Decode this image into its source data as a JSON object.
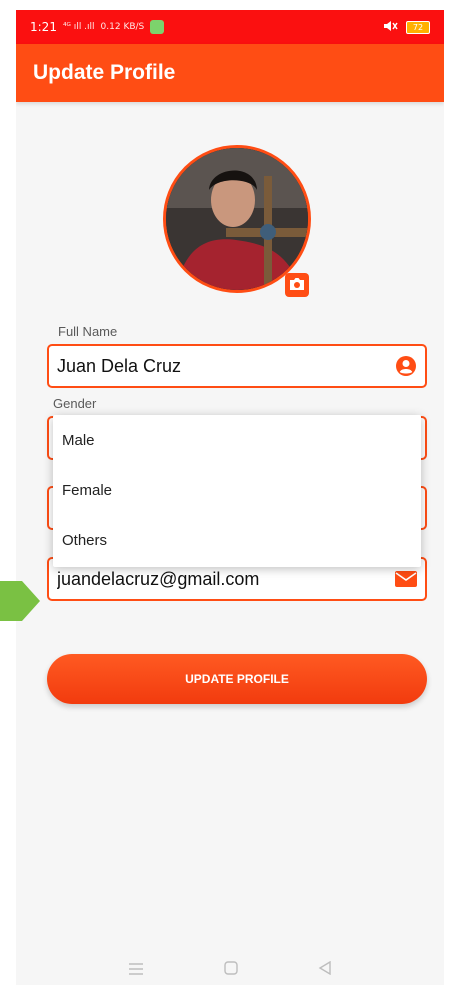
{
  "status_bar": {
    "time": "1:21",
    "network_labels": "⁴ᴳ ıll .ıll",
    "speed": "0.12 KB/S",
    "battery": "72"
  },
  "app_bar": {
    "title": "Update Profile"
  },
  "form": {
    "full_name_label": "Full Name",
    "full_name_value": "Juan Dela Cruz",
    "gender_label": "Gender",
    "email_value": "juandelacruz@gmail.com"
  },
  "gender_dropdown": {
    "options": [
      "Male",
      "Female",
      "Others"
    ]
  },
  "actions": {
    "update_label": "UPDATE PROFILE"
  },
  "colors": {
    "status_bar": "#fb1010",
    "accent": "#ff4d14",
    "pointer": "#7ac143"
  },
  "icons": {
    "profile_camera": "camera-icon",
    "name_field": "person-circle-icon",
    "email_field": "envelope-icon",
    "nav": [
      "menu-icon",
      "home-square-icon",
      "back-triangle-icon"
    ]
  }
}
